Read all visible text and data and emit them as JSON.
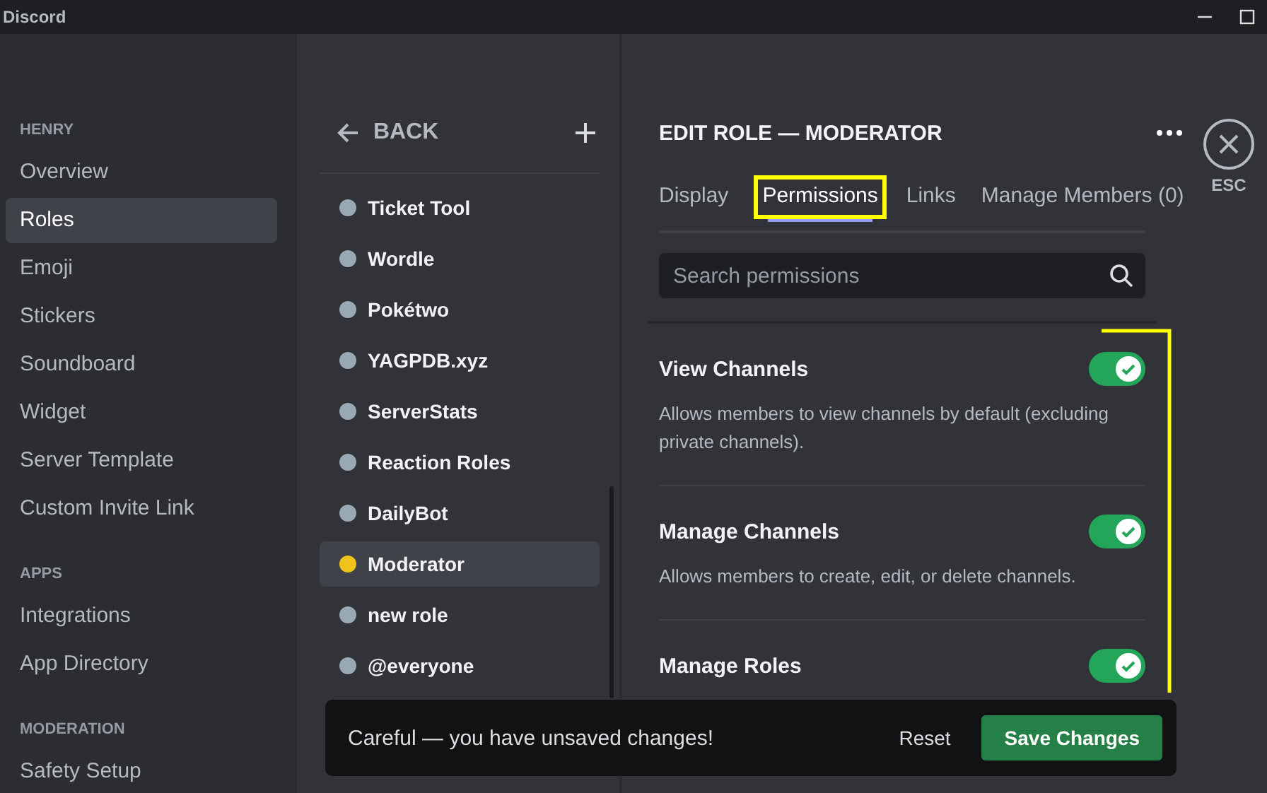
{
  "window": {
    "title": "Discord"
  },
  "sidebar": {
    "sections": [
      {
        "header": "HENRY",
        "items": [
          {
            "label": "Overview",
            "selected": false
          },
          {
            "label": "Roles",
            "selected": true
          },
          {
            "label": "Emoji",
            "selected": false
          },
          {
            "label": "Stickers",
            "selected": false
          },
          {
            "label": "Soundboard",
            "selected": false
          },
          {
            "label": "Widget",
            "selected": false
          },
          {
            "label": "Server Template",
            "selected": false
          },
          {
            "label": "Custom Invite Link",
            "selected": false
          }
        ]
      },
      {
        "header": "APPS",
        "items": [
          {
            "label": "Integrations",
            "selected": false
          },
          {
            "label": "App Directory",
            "selected": false
          }
        ]
      },
      {
        "header": "MODERATION",
        "items": [
          {
            "label": "Safety Setup",
            "selected": false
          }
        ]
      }
    ]
  },
  "roles": {
    "back_label": "BACK",
    "items": [
      {
        "name": "Ticket Tool",
        "color": "#99aab5",
        "selected": false
      },
      {
        "name": "Wordle",
        "color": "#99aab5",
        "selected": false
      },
      {
        "name": "Pokétwo",
        "color": "#99aab5",
        "selected": false
      },
      {
        "name": "YAGPDB.xyz",
        "color": "#99aab5",
        "selected": false
      },
      {
        "name": "ServerStats",
        "color": "#99aab5",
        "selected": false
      },
      {
        "name": "Reaction Roles",
        "color": "#99aab5",
        "selected": false
      },
      {
        "name": "DailyBot",
        "color": "#99aab5",
        "selected": false
      },
      {
        "name": "Moderator",
        "color": "#f0c31a",
        "selected": true
      },
      {
        "name": "new role",
        "color": "#99aab5",
        "selected": false
      },
      {
        "name": "@everyone",
        "color": "#99aab5",
        "selected": false
      }
    ]
  },
  "editor": {
    "title": "EDIT ROLE — MODERATOR",
    "close_label": "ESC",
    "tabs": [
      {
        "label": "Display",
        "selected": false,
        "highlighted": false
      },
      {
        "label": "Permissions",
        "selected": true,
        "highlighted": true
      },
      {
        "label": "Links",
        "selected": false,
        "highlighted": false
      },
      {
        "label": "Manage Members (0)",
        "selected": false,
        "highlighted": false
      }
    ],
    "search": {
      "placeholder": "Search permissions"
    },
    "permissions": [
      {
        "name": "View Channels",
        "description": "Allows members to view channels by default (excluding private channels).",
        "enabled": true
      },
      {
        "name": "Manage Channels",
        "description": "Allows members to create, edit, or delete channels.",
        "enabled": true
      },
      {
        "name": "Manage Roles",
        "enabled": true
      }
    ]
  },
  "toast": {
    "message": "Careful — you have unsaved changes!",
    "reset_label": "Reset",
    "save_label": "Save Changes"
  }
}
